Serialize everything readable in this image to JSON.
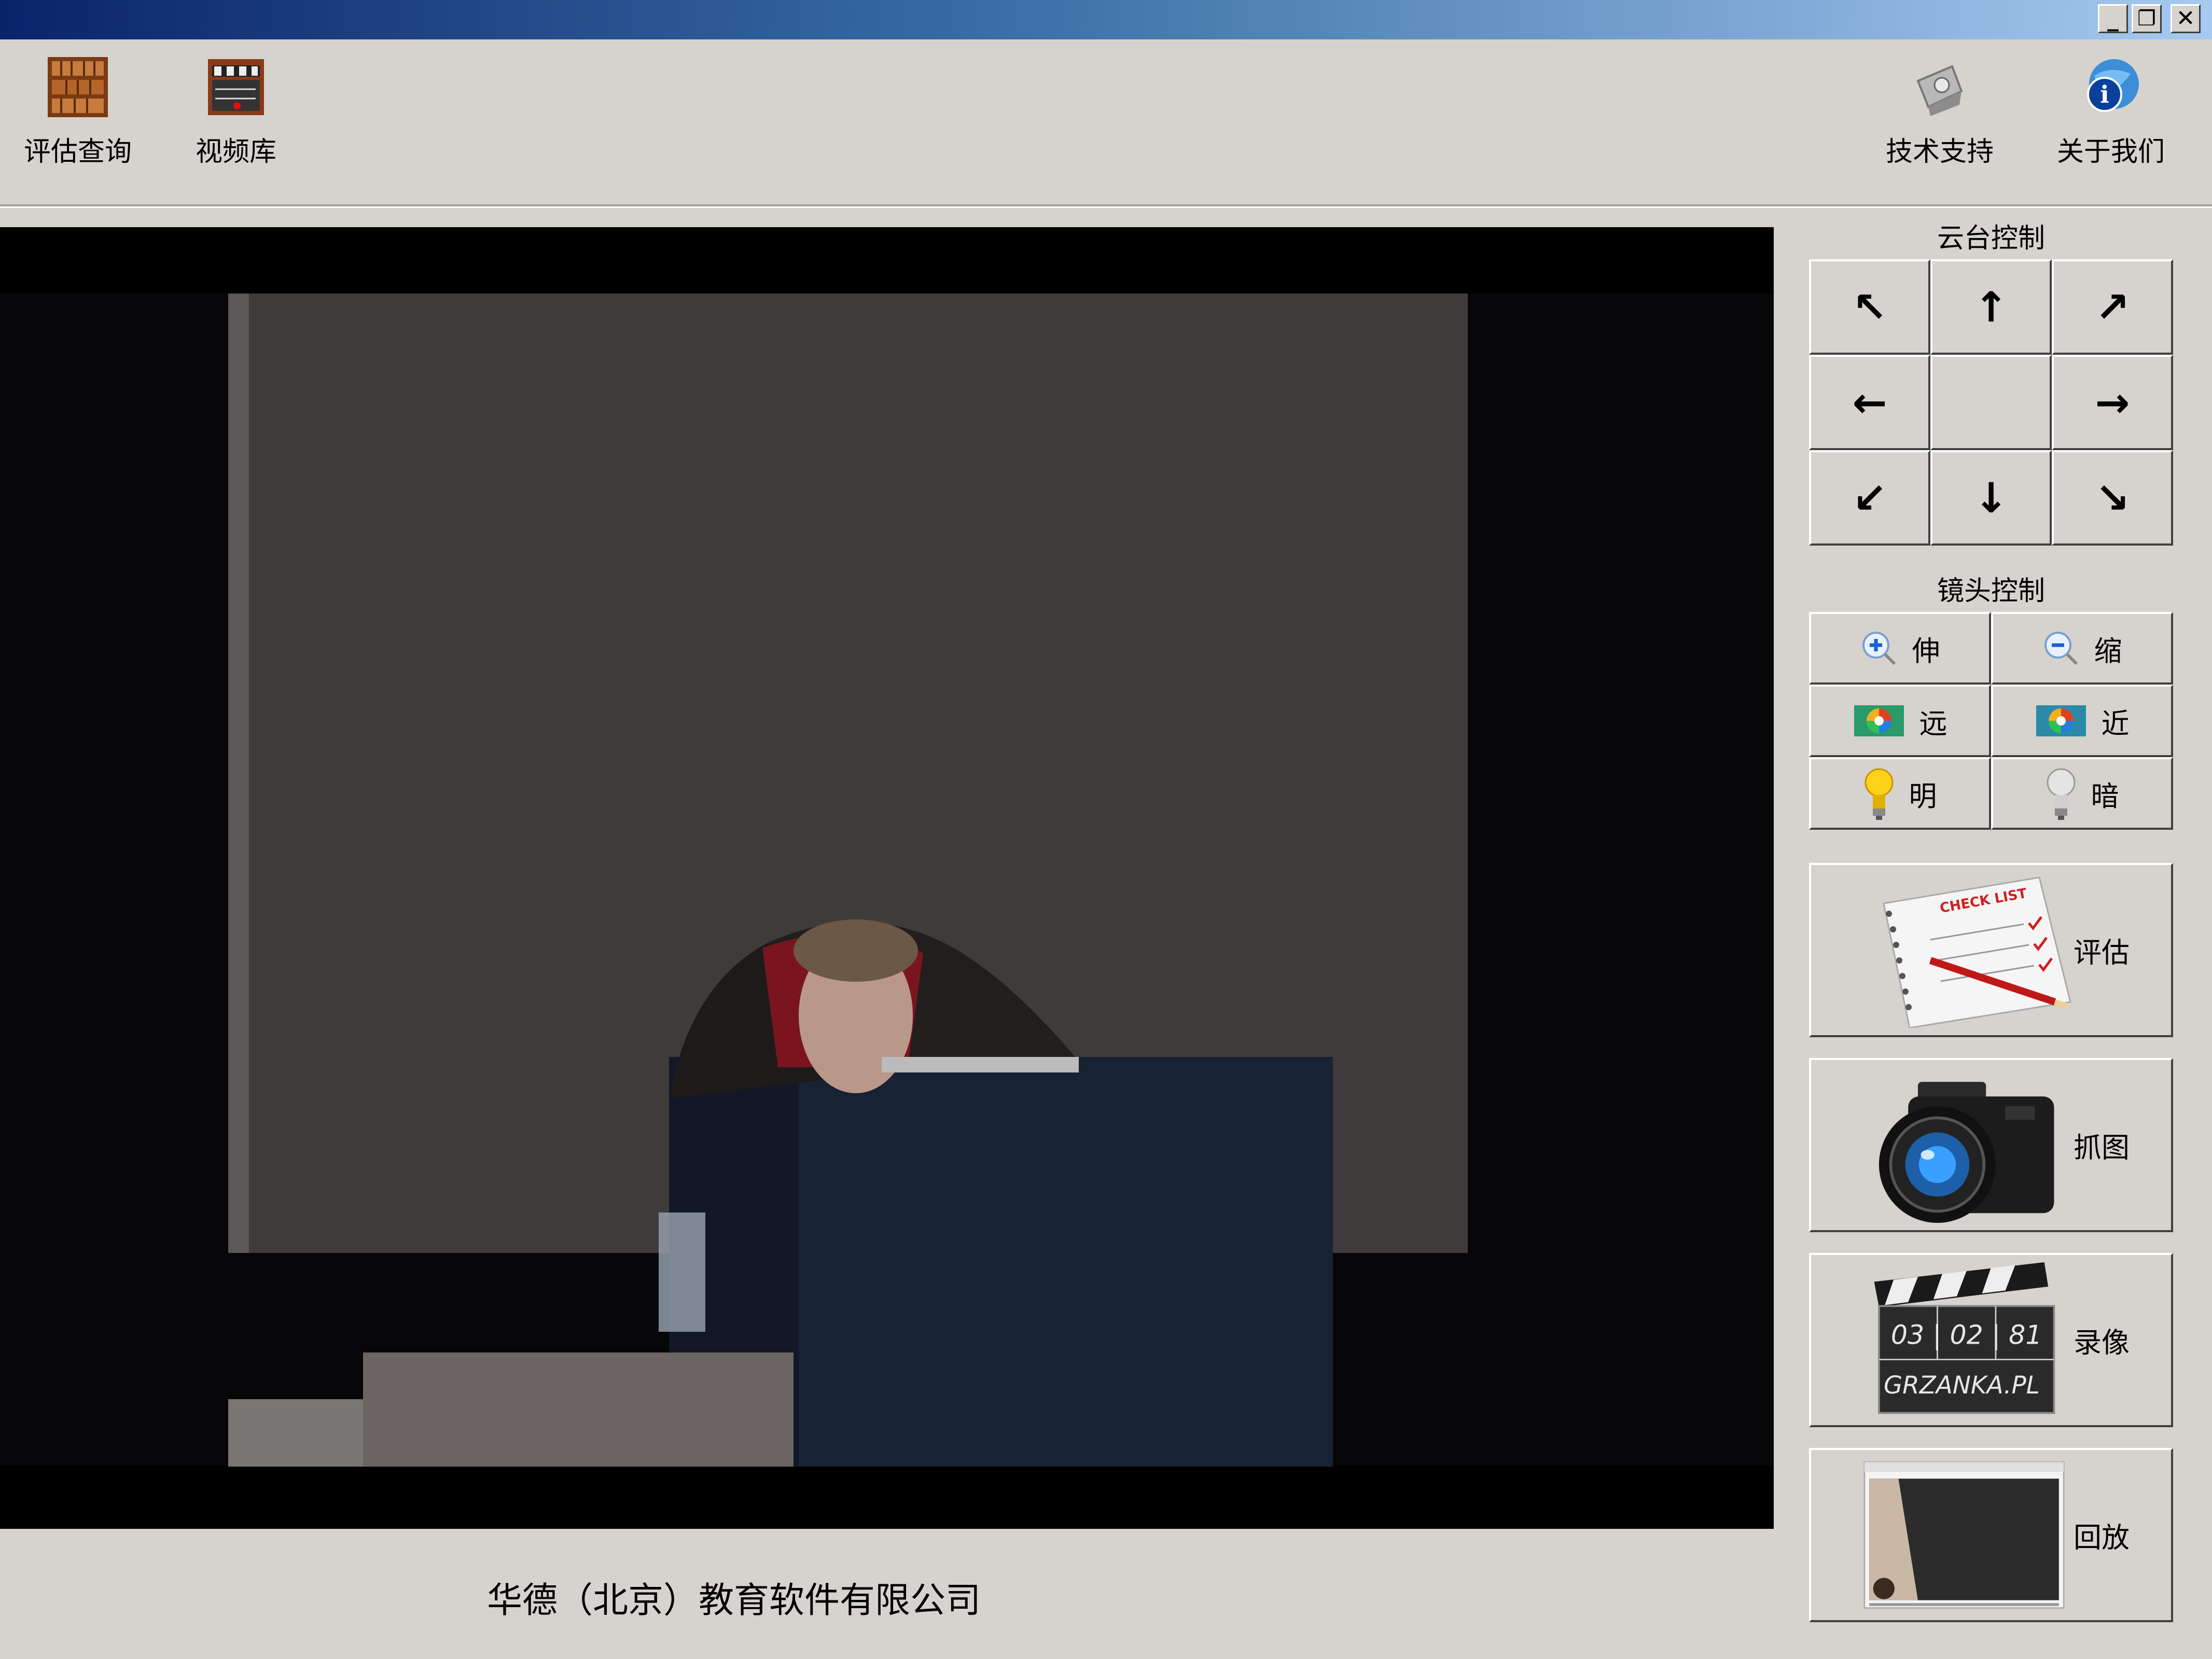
{
  "toolbar": {
    "left": [
      {
        "label": "评估查询",
        "icon": "bookshelf-icon"
      },
      {
        "label": "视频库",
        "icon": "clapperboard-icon"
      }
    ],
    "right": [
      {
        "label": "技术支持",
        "icon": "support-icon"
      },
      {
        "label": "关于我们",
        "icon": "info-globe-icon"
      }
    ]
  },
  "window_controls": {
    "minimize": "_",
    "restore": "❐",
    "close": "✕"
  },
  "ptz": {
    "title": "云台控制",
    "arrows": [
      "↖",
      "↑",
      "↗",
      "←",
      "",
      "→",
      "↙",
      "↓",
      "↘"
    ]
  },
  "lens": {
    "title": "镜头控制",
    "buttons": [
      {
        "label": "伸",
        "icon": "zoom-in-icon"
      },
      {
        "label": "缩",
        "icon": "zoom-out-icon"
      },
      {
        "label": "远",
        "icon": "focus-far-icon"
      },
      {
        "label": "近",
        "icon": "focus-near-icon"
      },
      {
        "label": "明",
        "icon": "bulb-on-icon"
      },
      {
        "label": "暗",
        "icon": "bulb-off-icon"
      }
    ]
  },
  "actions": [
    {
      "label": "评估",
      "icon": "checklist-icon"
    },
    {
      "label": "抓图",
      "icon": "camera-icon"
    },
    {
      "label": "录像",
      "icon": "clapperboard-icon"
    },
    {
      "label": "回放",
      "icon": "playback-screen-icon"
    }
  ],
  "clapper_text": {
    "line1": "03 | 02 | 81",
    "line2": "GRZANKA.PL"
  },
  "footer": "华德（北京）教育软件有限公司",
  "colors": {
    "titlebar_start": "#0a246a",
    "titlebar_end": "#a6caf0",
    "panel_bg": "#d6d3ce",
    "video_bg": "#000000"
  }
}
